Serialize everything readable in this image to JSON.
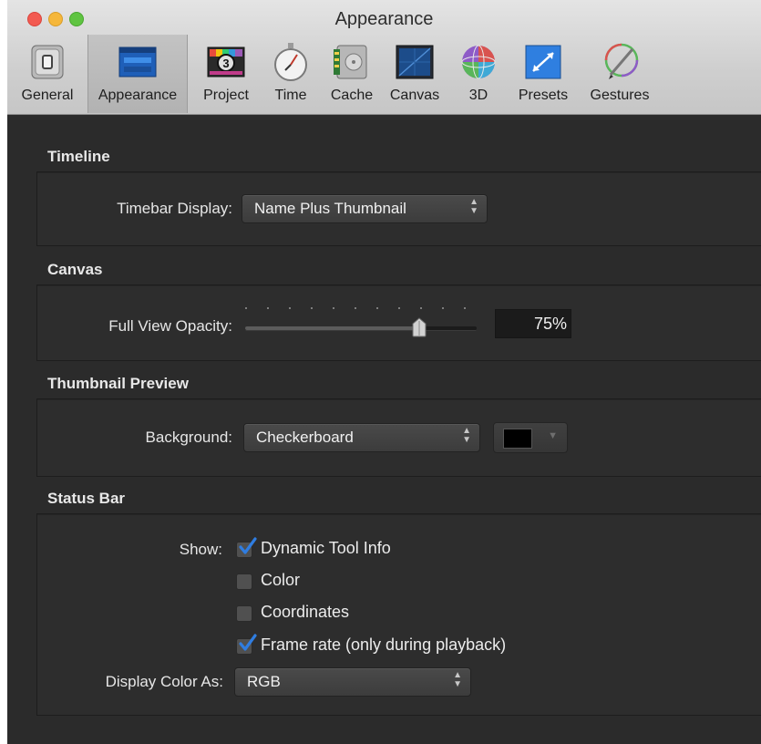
{
  "window": {
    "title": "Appearance"
  },
  "toolbar": {
    "items": [
      {
        "label": "General",
        "icon": "general-icon",
        "selected": false
      },
      {
        "label": "Appearance",
        "icon": "appearance-icon",
        "selected": true
      },
      {
        "label": "Project",
        "icon": "project-icon",
        "selected": false
      },
      {
        "label": "Time",
        "icon": "stopwatch-icon",
        "selected": false
      },
      {
        "label": "Cache",
        "icon": "cache-icon",
        "selected": false
      },
      {
        "label": "Canvas",
        "icon": "canvas-icon",
        "selected": false
      },
      {
        "label": "3D",
        "icon": "sphere-icon",
        "selected": false
      },
      {
        "label": "Presets",
        "icon": "presets-icon",
        "selected": false
      },
      {
        "label": "Gestures",
        "icon": "pen-icon",
        "selected": false
      }
    ]
  },
  "timeline": {
    "title": "Timeline",
    "timebar_label": "Timebar Display:",
    "timebar_value": "Name Plus Thumbnail"
  },
  "canvas": {
    "title": "Canvas",
    "opacity_label": "Full View Opacity:",
    "opacity_value": "75%",
    "opacity_fraction": 0.75
  },
  "thumbnail": {
    "title": "Thumbnail Preview",
    "background_label": "Background:",
    "background_value": "Checkerboard",
    "swatch_color": "#000000"
  },
  "status_bar": {
    "title": "Status Bar",
    "show_label": "Show:",
    "options": [
      {
        "label": "Dynamic Tool Info",
        "checked": true
      },
      {
        "label": "Color",
        "checked": false
      },
      {
        "label": "Coordinates",
        "checked": false
      },
      {
        "label": "Frame rate (only during playback)",
        "checked": true
      }
    ],
    "display_color_label": "Display Color As:",
    "display_color_value": "RGB"
  },
  "colors": {
    "checkmark": "#2f7de1",
    "panel": "#2b2b2b"
  }
}
